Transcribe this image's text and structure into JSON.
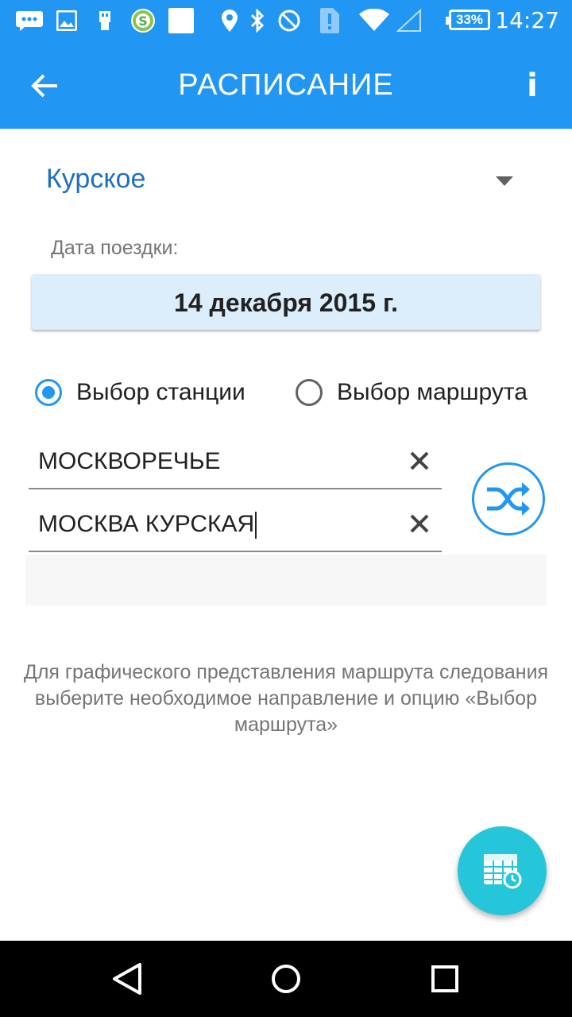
{
  "status_bar": {
    "time": "14:27",
    "battery": "33%",
    "icons": [
      "message-icon",
      "image-icon",
      "usb-icon",
      "money-app-icon",
      "blank-notification-icon",
      "location-icon",
      "bluetooth-icon",
      "do-not-disturb-icon",
      "alert-icon",
      "wifi-icon",
      "signal-icon"
    ],
    "color": "#2196f3"
  },
  "app_bar": {
    "title": "РАСПИСАНИЕ",
    "info_label": "i",
    "color": "#2196f3"
  },
  "direction": {
    "selected": "Курское"
  },
  "date": {
    "label": "Дата поездки:",
    "value": "14 декабря 2015 г."
  },
  "mode": {
    "options": [
      {
        "label": "Выбор станции",
        "selected": true
      },
      {
        "label": "Выбор маршрута",
        "selected": false
      }
    ]
  },
  "stations": {
    "from": "МОСКВОРЕЧЬЕ",
    "to": "МОСКВА КУРСКАЯ"
  },
  "hint": "Для графического представления маршрута следования выберите необходимое направление и опцию «Выбор маршрута»",
  "fab": {
    "icon": "schedule-calendar-icon",
    "color": "#26c6da"
  },
  "nav_bar": {
    "icons": [
      "back-triangle-icon",
      "home-circle-icon",
      "recents-square-icon"
    ]
  }
}
